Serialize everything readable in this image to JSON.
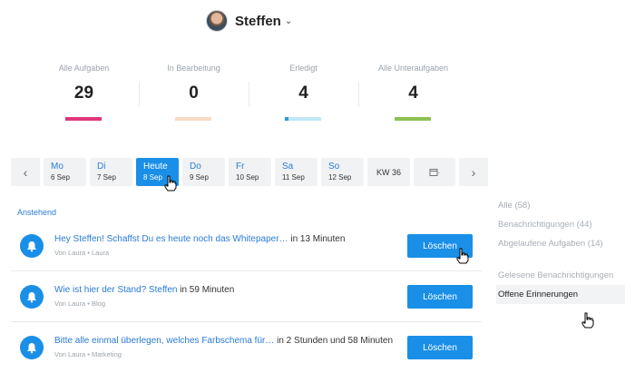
{
  "user": {
    "name": "Steffen"
  },
  "stats": [
    {
      "label": "Alle Aufgaben",
      "value": "29",
      "color": "#e2357a",
      "progress": 1.0
    },
    {
      "label": "In Bearbeitung",
      "value": "0",
      "color": "#f8dcc6",
      "progress": 1.0
    },
    {
      "label": "Erledigt",
      "value": "4",
      "color": "#bfe7f6",
      "progress": 1.0,
      "accent": "#2b9be0"
    },
    {
      "label": "Alle Unteraufgaben",
      "value": "4",
      "color": "#8cc152",
      "progress": 1.0
    }
  ],
  "days": [
    {
      "name": "Mo",
      "date": "6 Sep"
    },
    {
      "name": "Di",
      "date": "7 Sep"
    },
    {
      "name": "Heute",
      "date": "8 Sep",
      "active": true
    },
    {
      "name": "Do",
      "date": "9 Sep"
    },
    {
      "name": "Fr",
      "date": "10 Sep"
    },
    {
      "name": "Sa",
      "date": "11 Sep"
    },
    {
      "name": "So",
      "date": "12 Sep"
    }
  ],
  "week_label": "KW 36",
  "section_title": "Anstehend",
  "items": [
    {
      "link": "Hey Steffen! Schaffst Du es heute noch das Whitepaper…",
      "time": "in 13 Minuten",
      "meta": "Von Laura • Laura",
      "button": "Löschen"
    },
    {
      "link": "Wie ist hier der Stand? Steffen",
      "time": "in 59 Minuten",
      "meta": "Von Laura • Blog",
      "button": "Löschen"
    },
    {
      "link": "Bitte alle einmal überlegen, welches Farbschema für…",
      "time": "in 2 Stunden und 58 Minuten",
      "meta": "Von Laura • Marketing",
      "button": "Löschen"
    }
  ],
  "filters": {
    "group1": [
      "Alle (58)",
      "Benachrichtigungen (44)",
      "Abgelaufene Aufgaben (14)"
    ],
    "group2": [
      "Gelesene Benachrichtigungen",
      "Offene Erinnerungen"
    ],
    "active": "Offene Erinnerungen"
  },
  "colors": {
    "accent": "#1a8fe8",
    "link": "#2b7bd6"
  }
}
